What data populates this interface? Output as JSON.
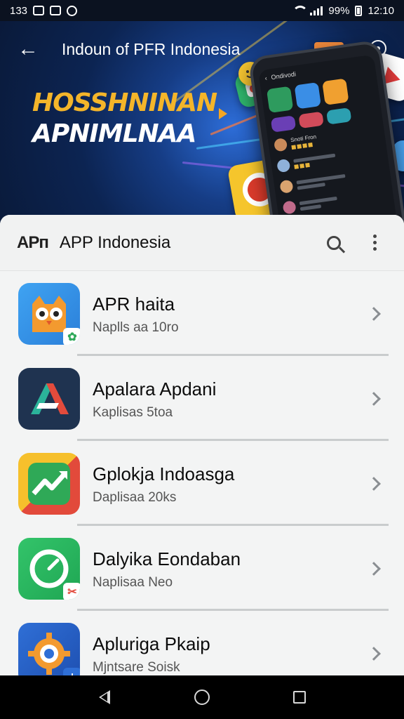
{
  "status_bar": {
    "left_text": "133",
    "left_icons": [
      "media-icon",
      "gallery-icon",
      "notification-icon"
    ],
    "battery_text": "99%",
    "time": "12:10"
  },
  "hero": {
    "title": "Indoun of PFR Indonesia",
    "headline_line1": "HOSSHNINAN",
    "headline_line2": "APNIMLNAA",
    "colors": {
      "headline_accent": "#f4b52a",
      "background": "#0c2452"
    }
  },
  "phone_mockup": {
    "header_text": "Ondivodi",
    "row_label": "Snoti Fron"
  },
  "sheet": {
    "logo_text": "APᴨ",
    "title": "APP Indonesia"
  },
  "apps": [
    {
      "title": "APR haita",
      "subtitle": "Naplls aa 10ro",
      "icon": "owl-app-icon",
      "badge": "leaf-badge-icon"
    },
    {
      "title": "Apalara Apdani",
      "subtitle": "Kaplisas 5toa",
      "icon": "letter-a-app-icon",
      "badge": ""
    },
    {
      "title": "Gplokja Indoasga",
      "subtitle": "Daplisaa 20ks",
      "icon": "trend-app-icon",
      "badge": ""
    },
    {
      "title": "Dalyika Eondaban",
      "subtitle": "Naplisaa Neo",
      "icon": "gauge-app-icon",
      "badge": "scissors-badge-icon"
    },
    {
      "title": "Apluriga Pkaip",
      "subtitle": "Mjntsare Soisk",
      "icon": "gear-app-icon",
      "badge": "plus-badge-icon"
    }
  ],
  "nav": {
    "icons": [
      "back-triangle-icon",
      "home-circle-icon",
      "recents-square-icon"
    ]
  }
}
